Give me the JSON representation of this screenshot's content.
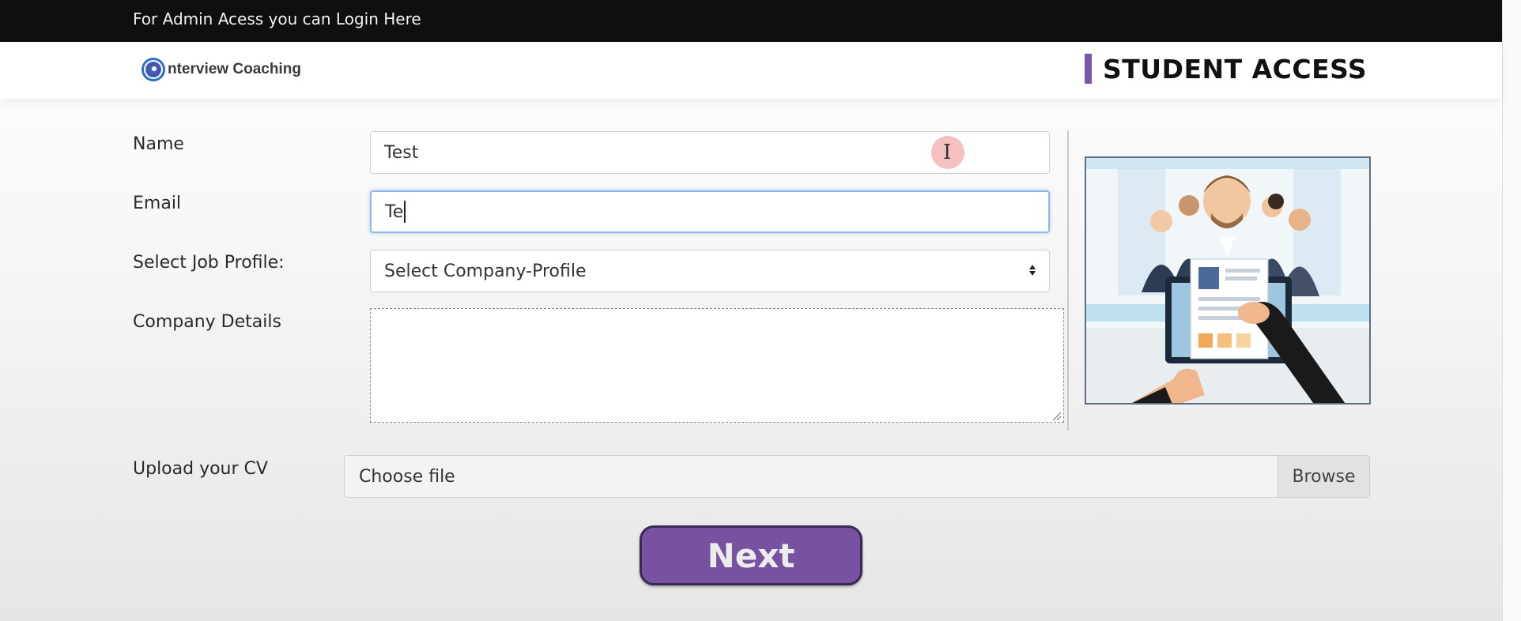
{
  "topbar": {
    "admin_link": "For Admin Acess you can Login Here"
  },
  "header": {
    "logo_text": "nterview Coaching",
    "access_title": "STUDENT ACCESS"
  },
  "form": {
    "name": {
      "label": "Name",
      "value": "Test"
    },
    "email": {
      "label": "Email",
      "value": "Te"
    },
    "job_profile": {
      "label": "Select Job Profile:",
      "selected": "Select Company-Profile"
    },
    "company_details": {
      "label": "Company Details",
      "value": ""
    },
    "cv": {
      "label": "Upload your CV",
      "file_text": "Choose file",
      "browse_label": "Browse"
    },
    "next_label": "Next"
  },
  "colors": {
    "accent": "#7652a1",
    "topbar": "#0f0f0f",
    "focus": "#8fb8e8"
  },
  "icons": {
    "select": "up-down-arrows-icon",
    "cursor": "text-cursor-icon",
    "resize": "resize-handle-icon"
  }
}
